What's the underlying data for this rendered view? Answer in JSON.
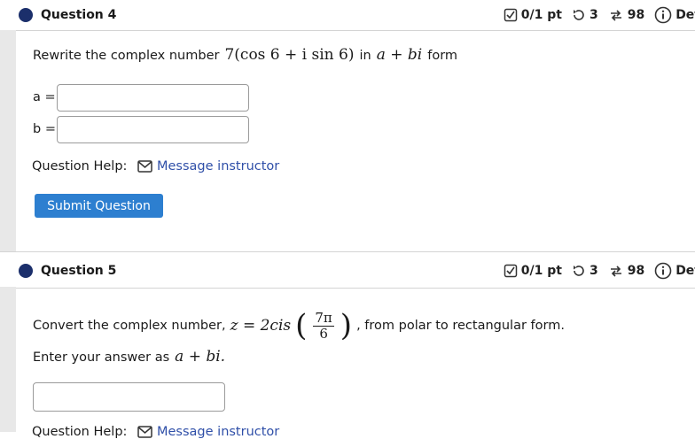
{
  "q4": {
    "title": "Question 4",
    "score": "0/1 pt",
    "attempts": "3",
    "versions": "98",
    "details": "Det",
    "prompt_before": "Rewrite the complex number",
    "prompt_after": "in",
    "prompt_end": "form",
    "math_expr": "7(cos 6 + i sin 6)",
    "math_form": "a + bi",
    "field_a_label": "a =",
    "field_a_value": "",
    "field_b_label": "b =",
    "field_b_value": "",
    "help_label": "Question Help:",
    "help_link": "Message instructor",
    "submit_label": "Submit Question"
  },
  "q5": {
    "title": "Question 5",
    "score": "0/1 pt",
    "attempts": "3",
    "versions": "98",
    "details": "Det",
    "prompt_before": "Convert the complex number,",
    "math_lhs": "z = 2cis",
    "frac_num": "7π",
    "frac_den": "6",
    "prompt_after": ", from polar to rectangular form.",
    "instruction": "Enter your answer as",
    "instruction_math": "a + bi.",
    "answer_value": "",
    "help_label": "Question Help:",
    "help_link": "Message instructor"
  },
  "colors": {
    "bullet": "#1b2f6b",
    "submit_bg": "#2d7fd0",
    "link": "#2f4fa8",
    "divider": "#d4d4d4"
  }
}
